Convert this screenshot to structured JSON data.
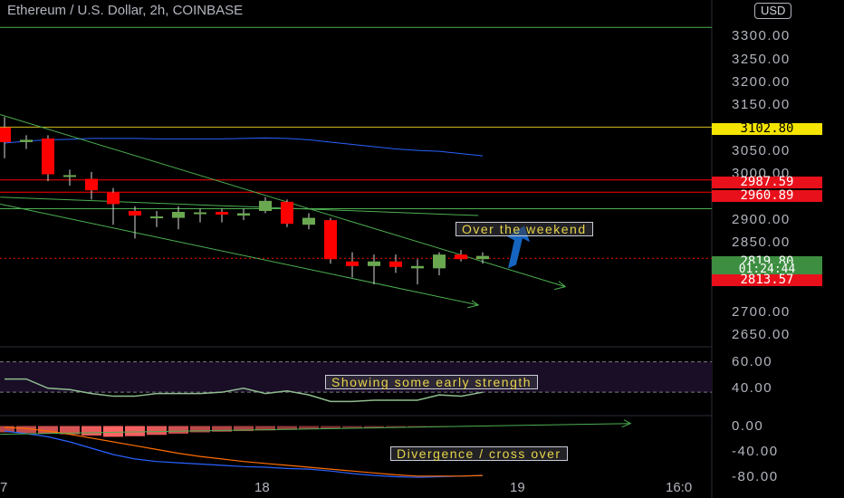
{
  "header": {
    "title": "Ethereum / U.S. Dollar, 2h, COINBASE",
    "currency_badge": "USD"
  },
  "annotations": {
    "weekend": "Over the weekend",
    "strength": "Showing some early strength",
    "divergence": "Divergence / cross over"
  },
  "price_tags": {
    "yellow_level": "3102.80",
    "resistance_1": "2987.59",
    "resistance_2": "2960.89",
    "last_price": "2819.80",
    "countdown": "01:24:44",
    "low_level": "2813.57"
  },
  "colors": {
    "bull": "#6aa84f",
    "bear": "#ff0000",
    "yellow_line": "#d4c020",
    "green_line": "#4caf50",
    "rsi_panel": "#1a0d26",
    "arrow": "#1565c0"
  },
  "time_axis": [
    "7",
    "18",
    "19",
    "16:0"
  ],
  "chart_data": [
    {
      "type": "candlestick",
      "title": "Ethereum / U.S. Dollar, 2h, COINBASE",
      "ylim": [
        2630,
        3350
      ],
      "y_ticks": [
        "3300.00",
        "3250.00",
        "3200.00",
        "3150.00",
        "3050.00",
        "3000.00",
        "2900.00",
        "2850.00",
        "2700.00",
        "2650.00"
      ],
      "y_tick_values": [
        3300,
        3250,
        3200,
        3150,
        3050,
        3000,
        2900,
        2850,
        2700,
        2650
      ],
      "candles": [
        {
          "o": 3102,
          "h": 3125,
          "l": 3035,
          "c": 3070
        },
        {
          "o": 3070,
          "h": 3085,
          "l": 3055,
          "c": 3075
        },
        {
          "o": 3078,
          "h": 3085,
          "l": 2985,
          "c": 3000
        },
        {
          "o": 2995,
          "h": 3010,
          "l": 2975,
          "c": 2998
        },
        {
          "o": 2990,
          "h": 3005,
          "l": 2945,
          "c": 2965
        },
        {
          "o": 2960,
          "h": 2970,
          "l": 2890,
          "c": 2935
        },
        {
          "o": 2920,
          "h": 2930,
          "l": 2860,
          "c": 2910
        },
        {
          "o": 2905,
          "h": 2920,
          "l": 2885,
          "c": 2908
        },
        {
          "o": 2905,
          "h": 2930,
          "l": 2880,
          "c": 2918
        },
        {
          "o": 2915,
          "h": 2925,
          "l": 2895,
          "c": 2917
        },
        {
          "o": 2918,
          "h": 2925,
          "l": 2895,
          "c": 2912
        },
        {
          "o": 2910,
          "h": 2925,
          "l": 2900,
          "c": 2915
        },
        {
          "o": 2920,
          "h": 2950,
          "l": 2915,
          "c": 2942
        },
        {
          "o": 2940,
          "h": 2945,
          "l": 2885,
          "c": 2892
        },
        {
          "o": 2890,
          "h": 2915,
          "l": 2880,
          "c": 2905
        },
        {
          "o": 2900,
          "h": 2905,
          "l": 2805,
          "c": 2815
        },
        {
          "o": 2810,
          "h": 2830,
          "l": 2775,
          "c": 2800
        },
        {
          "o": 2800,
          "h": 2825,
          "l": 2760,
          "c": 2810
        },
        {
          "o": 2810,
          "h": 2825,
          "l": 2785,
          "c": 2798
        },
        {
          "o": 2795,
          "h": 2815,
          "l": 2760,
          "c": 2800
        },
        {
          "o": 2795,
          "h": 2830,
          "l": 2780,
          "c": 2825
        },
        {
          "o": 2825,
          "h": 2835,
          "l": 2810,
          "c": 2815
        },
        {
          "o": 2815,
          "h": 2830,
          "l": 2805,
          "c": 2822
        }
      ],
      "horizontal_levels": [
        {
          "value": 3320,
          "color": "green"
        },
        {
          "value": 3102.8,
          "color": "yellow"
        },
        {
          "value": 2987.59,
          "color": "red"
        },
        {
          "value": 2960.89,
          "color": "red"
        },
        {
          "value": 2925,
          "color": "green"
        },
        {
          "value": 2817,
          "color": "red"
        }
      ],
      "moving_average": [
        3068,
        3072,
        3075,
        3076,
        3078,
        3078,
        3078,
        3077,
        3077,
        3077,
        3077,
        3078,
        3079,
        3078,
        3075,
        3070,
        3065,
        3060,
        3055,
        3052,
        3050,
        3045,
        3040
      ]
    },
    {
      "type": "line",
      "title": "RSI",
      "ylim": [
        20,
        70
      ],
      "y_ticks": [
        "60.00",
        "40.00"
      ],
      "y_tick_values": [
        60,
        40
      ],
      "values": [
        47,
        47,
        40,
        39,
        36,
        34,
        34,
        36,
        36,
        36,
        37,
        40,
        36,
        38,
        35,
        30,
        30,
        31,
        31,
        31,
        35,
        34,
        37
      ]
    },
    {
      "type": "bar",
      "title": "MACD",
      "ylim": [
        -85,
        15
      ],
      "y_ticks": [
        "0.00",
        "-40.00",
        "-80.00"
      ],
      "y_tick_values": [
        0,
        -40,
        -80
      ],
      "histogram": [
        -10,
        -11,
        -12,
        -13,
        -15,
        -17,
        -16,
        -14,
        -12,
        -10,
        -9,
        -8,
        -7,
        -6,
        -5,
        -4,
        -3,
        -3,
        -2,
        -2,
        -1.5,
        -1,
        -0.5
      ],
      "macd_line": [
        -8,
        -12,
        -17,
        -25,
        -35,
        -45,
        -52,
        -56,
        -58,
        -60,
        -62,
        -64,
        -65,
        -67,
        -68,
        -71,
        -75,
        -78,
        -80,
        -81,
        -80,
        -79,
        -78
      ],
      "signal_line": [
        -2,
        -4,
        -8,
        -13,
        -19,
        -25,
        -31,
        -37,
        -43,
        -48,
        -52,
        -56,
        -59,
        -62,
        -65,
        -68,
        -71,
        -74,
        -77,
        -79,
        -79,
        -79,
        -78
      ]
    }
  ]
}
